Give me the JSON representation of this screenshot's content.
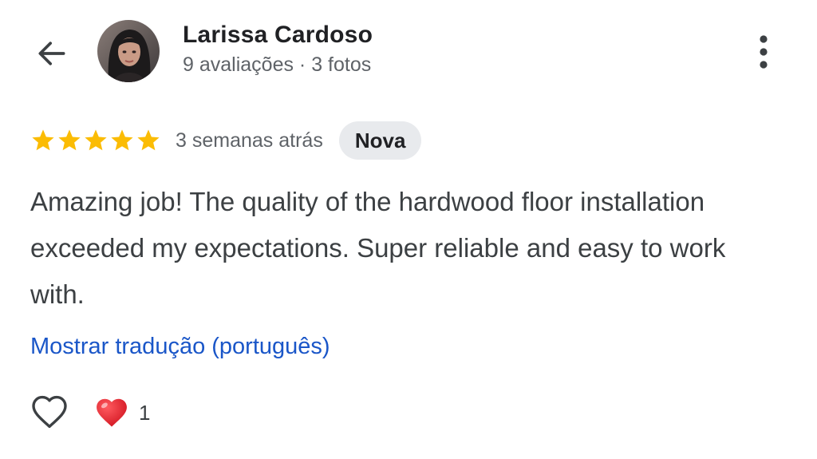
{
  "header": {
    "back_icon": "arrow-left-icon",
    "reviewer_name": "Larissa Cardoso",
    "reviewer_meta": "9 avaliações · 3 fotos",
    "more_icon": "more-vertical-icon"
  },
  "review": {
    "rating": 5,
    "max_rating": 5,
    "star_color": "#FBBC04",
    "time_ago": "3 semanas atrás",
    "badge": "Nova",
    "text": "Amazing job! The quality of the hardwood floor installation exceeded my expectations. Super reliable and easy to work with.",
    "translate_link": "Mostrar tradução (português)"
  },
  "actions": {
    "like_icon": "heart-outline-icon",
    "reaction_icon": "red-heart-icon",
    "reaction_count": "1"
  },
  "colors": {
    "link": "#1A56C8",
    "badge_bg": "#E8EAED",
    "heart_red": "#E0202A"
  }
}
